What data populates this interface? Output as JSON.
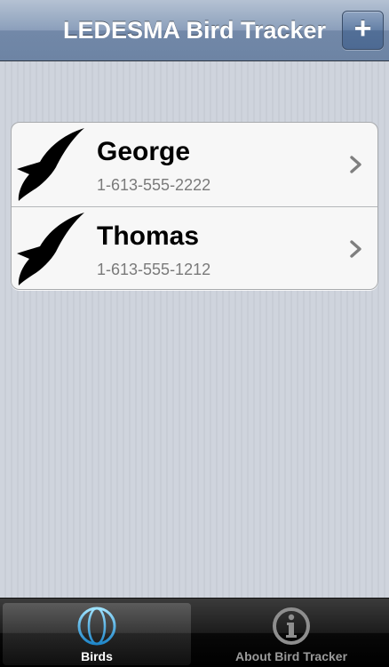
{
  "navbar": {
    "title": "LEDESMA Bird Tracker",
    "add_button_label": "+"
  },
  "birds": [
    {
      "name": "George",
      "phone": "1-613-555-2222",
      "icon": "bird-silhouette-icon"
    },
    {
      "name": "Thomas",
      "phone": "1-613-555-1212",
      "icon": "bird-silhouette-icon"
    }
  ],
  "tabbar": {
    "tabs": [
      {
        "label": "Birds",
        "icon": "globe-icon",
        "selected": true
      },
      {
        "label": "About Bird Tracker",
        "icon": "info-icon",
        "selected": false
      }
    ]
  },
  "colors": {
    "navbar": "#7288a8",
    "tab_selected": "#ffffff",
    "tab_unselected": "#9a9a9a",
    "phone_text": "#7a7a7a"
  }
}
